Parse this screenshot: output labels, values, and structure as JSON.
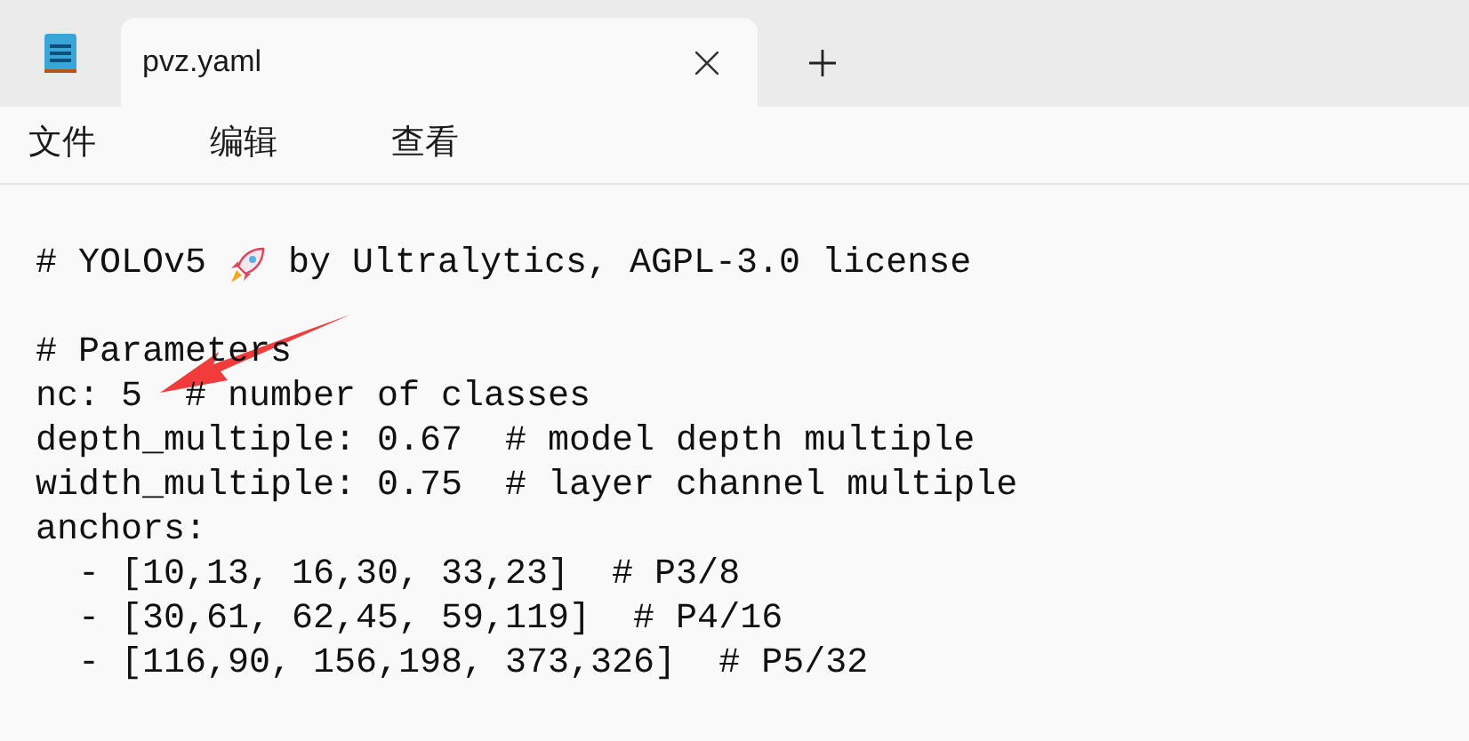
{
  "tabs": [
    {
      "label": "pvz.yaml",
      "selected": true
    }
  ],
  "menu": [
    "文件",
    "编辑",
    "查看"
  ],
  "lines": [
    {
      "kind": "blank"
    },
    {
      "kind": "icon_text",
      "before": "# YOLOv5",
      "after": "by Ultralytics, AGPL-3.0 license"
    },
    {
      "kind": "blank"
    },
    {
      "kind": "text",
      "text": "# Parameters"
    },
    {
      "kind": "text",
      "text": "nc: 5  # number of classes"
    },
    {
      "kind": "text",
      "text": "depth_multiple: 0.67  # model depth multiple"
    },
    {
      "kind": "text",
      "text": "width_multiple: 0.75  # layer channel multiple"
    },
    {
      "kind": "text",
      "text": "anchors:"
    },
    {
      "kind": "text",
      "text": "  - [10,13, 16,30, 33,23]  # P3/8"
    },
    {
      "kind": "text",
      "text": "  - [30,61, 62,45, 59,119]  # P4/16"
    },
    {
      "kind": "text",
      "text": "  - [116,90, 156,198, 373,326]  # P5/32"
    }
  ]
}
